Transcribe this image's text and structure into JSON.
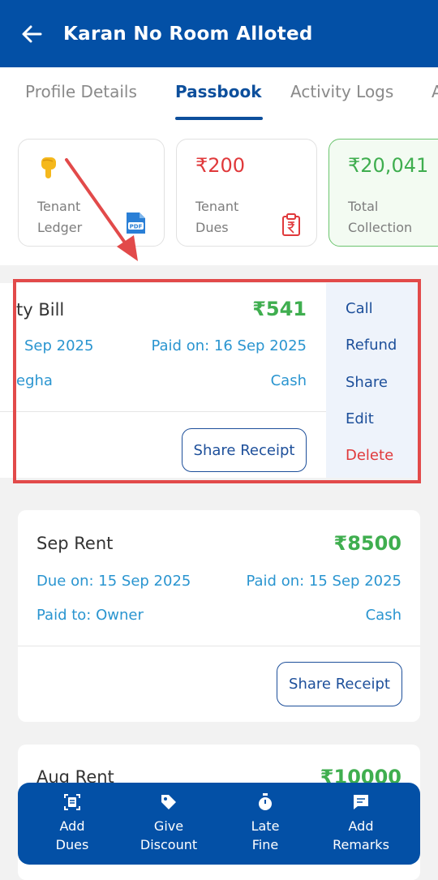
{
  "header": {
    "title": "Karan No Room Alloted"
  },
  "tabs": [
    {
      "label": "Profile Details"
    },
    {
      "label": "Passbook"
    },
    {
      "label": "Activity Logs"
    },
    {
      "label": "A"
    }
  ],
  "summary": {
    "ledger": {
      "label_line1": "Tenant",
      "label_line2": "Ledger"
    },
    "dues": {
      "amount": "₹200",
      "label_line1": "Tenant",
      "label_line2": "Dues"
    },
    "collection": {
      "amount": "₹20,041",
      "label_line1": "Total",
      "label_line2": "Collection"
    }
  },
  "transactions": [
    {
      "name": "ty Bill",
      "amount": "₹541",
      "due": "Sep 2025",
      "paid_on": "Paid on: 16 Sep 2025",
      "paid_to": "egha",
      "mode": "Cash",
      "share_label": "Share Receipt"
    },
    {
      "name": "Sep Rent",
      "amount": "₹8500",
      "due": "Due on: 15 Sep 2025",
      "paid_on": "Paid on: 15 Sep 2025",
      "paid_to": "Paid to: Owner",
      "mode": "Cash",
      "share_label": "Share Receipt"
    },
    {
      "name": "Aug Rent",
      "amount": "₹10000"
    }
  ],
  "actions": [
    {
      "label": "Call"
    },
    {
      "label": "Refund"
    },
    {
      "label": "Share"
    },
    {
      "label": "Edit"
    },
    {
      "label": "Delete"
    }
  ],
  "bottom_bar": [
    {
      "line1": "Add",
      "line2": "Dues",
      "icon": "receipt-scan-icon"
    },
    {
      "line1": "Give",
      "line2": "Discount",
      "icon": "tag-icon"
    },
    {
      "line1": "Late",
      "line2": "Fine",
      "icon": "stopwatch-icon"
    },
    {
      "line1": "Add",
      "line2": "Remarks",
      "icon": "comment-icon"
    }
  ],
  "colors": {
    "primary": "#0350a6",
    "paid_green": "#3fae4f",
    "due_red": "#e0393b",
    "info_blue": "#2a95d0",
    "annotation_red": "#e24a4a"
  }
}
